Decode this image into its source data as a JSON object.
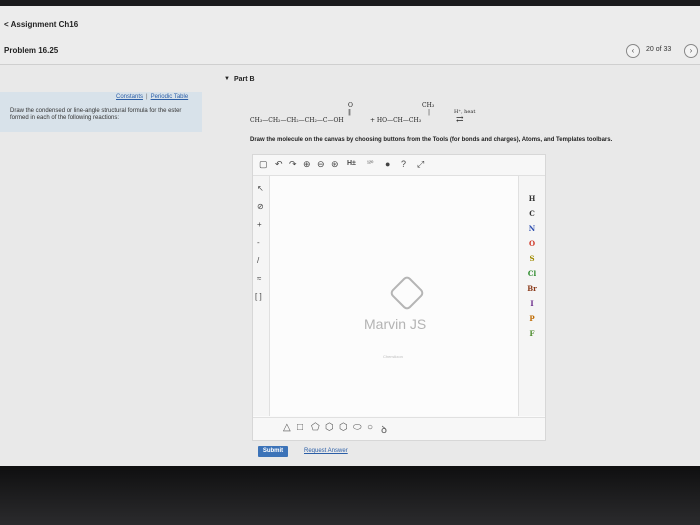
{
  "header": {
    "back_link": "< Assignment Ch16",
    "problem_title": "Problem 16.25",
    "prev_icon": "chevron-left-icon",
    "next_icon": "chevron-right-icon",
    "page_counter": "20 of 33"
  },
  "part": {
    "caret": "▼",
    "label": "Part B"
  },
  "sidebar": {
    "link_constants": "Constants",
    "separator": "|",
    "link_periodic": "Periodic Table",
    "instructions": "Draw the condensed or line-angle structural formula for the ester formed in each of the following reactions:"
  },
  "equation": {
    "carbonyl_o": "O",
    "double_bond": "‖",
    "acid": "CH₃—CH₂—CH₂—CH₂—C—OH",
    "plus_alcohol": "+ HO—CH—CH₃",
    "methyl_branch": "CH₃",
    "branch_bond": "|",
    "conditions": "H⁺, heat",
    "arrow": "⇄"
  },
  "directions": "Draw the molecule on the canvas by choosing buttons from the Tools (for bonds and charges), Atoms, and Templates toolbars.",
  "editor": {
    "top_tools": [
      "▢",
      "↶",
      "↷",
      "⊕",
      "⊖",
      "⊛",
      "H±",
      "¹²⁰",
      "●",
      "?",
      "⤢"
    ],
    "left_tools": [
      "↖",
      "⊘",
      "+",
      "-",
      "/",
      "≈",
      "[ ]"
    ],
    "elements": [
      {
        "symbol": "H",
        "color": "#333333"
      },
      {
        "symbol": "C",
        "color": "#333333"
      },
      {
        "symbol": "N",
        "color": "#2f4fb0"
      },
      {
        "symbol": "O",
        "color": "#d03a2a"
      },
      {
        "symbol": "S",
        "color": "#a08a00"
      },
      {
        "symbol": "Cl",
        "color": "#2a8a2a"
      },
      {
        "symbol": "Br",
        "color": "#8a3a1a"
      },
      {
        "symbol": "I",
        "color": "#6a2a8a"
      },
      {
        "symbol": "P",
        "color": "#c06a00"
      },
      {
        "symbol": "F",
        "color": "#4a8a2a"
      }
    ],
    "shapes": [
      "△",
      "□",
      "⬠",
      "⬡",
      "⬡",
      "⬭",
      "○",
      "ꝺ"
    ],
    "watermark": "Marvin JS",
    "vendor": "ChemAxon"
  },
  "actions": {
    "submit": "Submit",
    "request_answer": "Request Answer"
  }
}
